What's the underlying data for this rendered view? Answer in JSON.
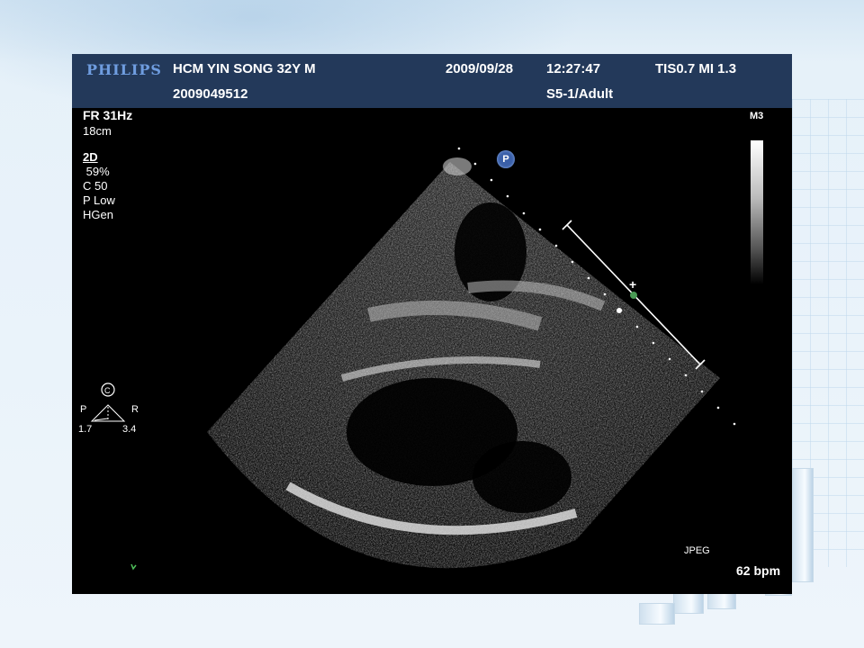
{
  "header": {
    "logo": "PHILIPS",
    "patient": "HCM YIN SONG  32Y M",
    "patient_id": "2009049512",
    "date": "2009/09/28",
    "time": "12:27:47",
    "tis_mi": "TIS0.7   MI 1.3",
    "probe": "S5-1/Adult"
  },
  "left_panel": {
    "frame_rate": "FR 31Hz",
    "depth": "18cm",
    "mode": "2D",
    "gain": " 59%",
    "compress": "C 50",
    "power": "P Low",
    "freq": "HGen"
  },
  "orientation": {
    "center_mark": "C",
    "left_label": "P",
    "right_label": "R",
    "left_value": "1.7",
    "right_value": "3.4"
  },
  "right_panel": {
    "map": "M3",
    "format": "JPEG",
    "heart_rate": "62 bpm"
  },
  "markers": {
    "probe_badge": "P",
    "cursor": "+"
  }
}
